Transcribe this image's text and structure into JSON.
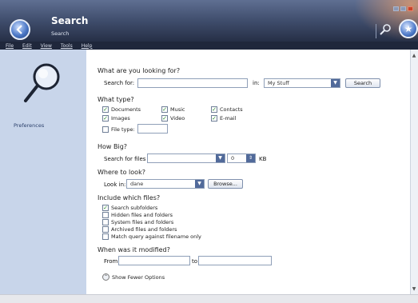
{
  "header": {
    "title": "Search",
    "subtitle": "Search"
  },
  "menu": [
    "File",
    "Edit",
    "View",
    "Tools",
    "Help"
  ],
  "sidebar": {
    "preferences": "Preferences"
  },
  "form": {
    "looking_heading": "What are you looking for?",
    "search_for_label": "Search for:",
    "search_for_value": "",
    "in_label": "in:",
    "in_value": "My Stuff",
    "search_button": "Search",
    "type_heading": "What type?",
    "types": [
      {
        "label": "Documents",
        "checked": true
      },
      {
        "label": "Music",
        "checked": true
      },
      {
        "label": "Contacts",
        "checked": true
      },
      {
        "label": "Images",
        "checked": true
      },
      {
        "label": "Video",
        "checked": true
      },
      {
        "label": "E-mail",
        "checked": true
      }
    ],
    "file_type_label": "File type:",
    "file_type_checked": false,
    "file_type_value": "",
    "big_heading": "How Big?",
    "search_files_label": "Search for files",
    "size_value": "0",
    "size_unit": "KB",
    "where_heading": "Where to look?",
    "look_in_label": "Look in:",
    "look_in_value": "dane",
    "browse_button": "Browse...",
    "include_heading": "Include which files?",
    "include": [
      {
        "label": "Search subfolders",
        "checked": true
      },
      {
        "label": "Hidden files and folders",
        "checked": false
      },
      {
        "label": "System files and folders",
        "checked": false
      },
      {
        "label": "Archived files and folders",
        "checked": false
      },
      {
        "label": "Match query against filename only",
        "checked": false
      }
    ],
    "modified_heading": "When was it modified?",
    "from_label": "From",
    "to_label": "to",
    "from_value": "",
    "to_value": "",
    "fewer_options": "Show Fewer Options"
  }
}
